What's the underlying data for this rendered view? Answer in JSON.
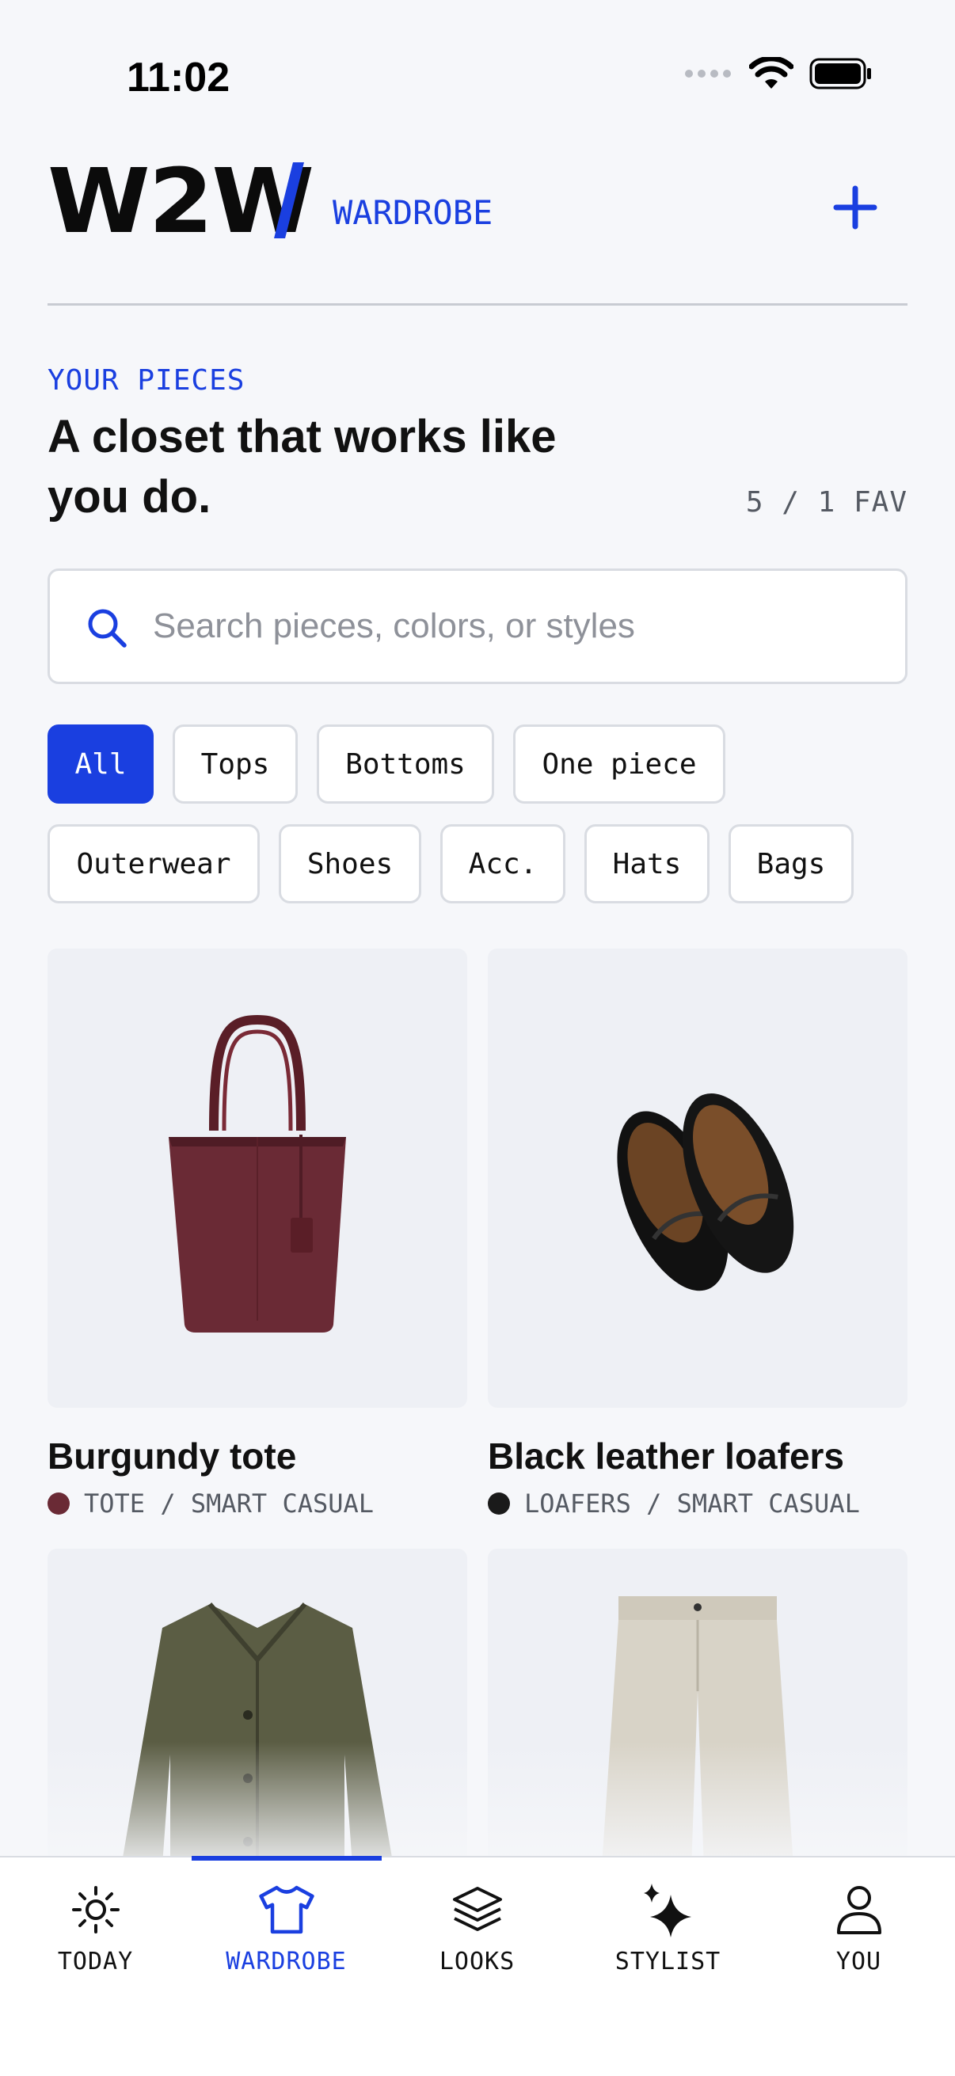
{
  "status_bar": {
    "time": "11:02"
  },
  "header": {
    "logo": "W2W",
    "section": "WARDROBE",
    "add_icon": "plus-icon"
  },
  "hero": {
    "eyebrow": "YOUR PIECES",
    "headline": "A closet that works like you do.",
    "count": "5 / 1 FAV"
  },
  "search": {
    "placeholder": "Search pieces, colors, or styles",
    "value": ""
  },
  "filters": {
    "row1": [
      "All",
      "Tops",
      "Bottoms",
      "One piece"
    ],
    "row2": [
      "Outerwear",
      "Shoes",
      "Acc.",
      "Hats",
      "Bags"
    ],
    "active": "All"
  },
  "items": [
    {
      "name": "Burgundy tote",
      "meta": "TOTE / SMART CASUAL",
      "color": "#6a2a35"
    },
    {
      "name": "Black leather loafers",
      "meta": "LOAFERS / SMART CASUAL",
      "color": "#1a1a1a"
    },
    {
      "name": "",
      "meta": "",
      "color": "#5b5d44"
    },
    {
      "name": "",
      "meta": "",
      "color": "#d8d3c7"
    }
  ],
  "tabs": [
    {
      "label": "TODAY",
      "icon": "sun-icon"
    },
    {
      "label": "WARDROBE",
      "icon": "tshirt-icon",
      "active": true
    },
    {
      "label": "LOOKS",
      "icon": "layers-icon"
    },
    {
      "label": "STYLIST",
      "icon": "sparkle-icon"
    },
    {
      "label": "YOU",
      "icon": "person-icon"
    }
  ],
  "colors": {
    "accent": "#1a3fe0",
    "background": "#f6f7fa"
  }
}
